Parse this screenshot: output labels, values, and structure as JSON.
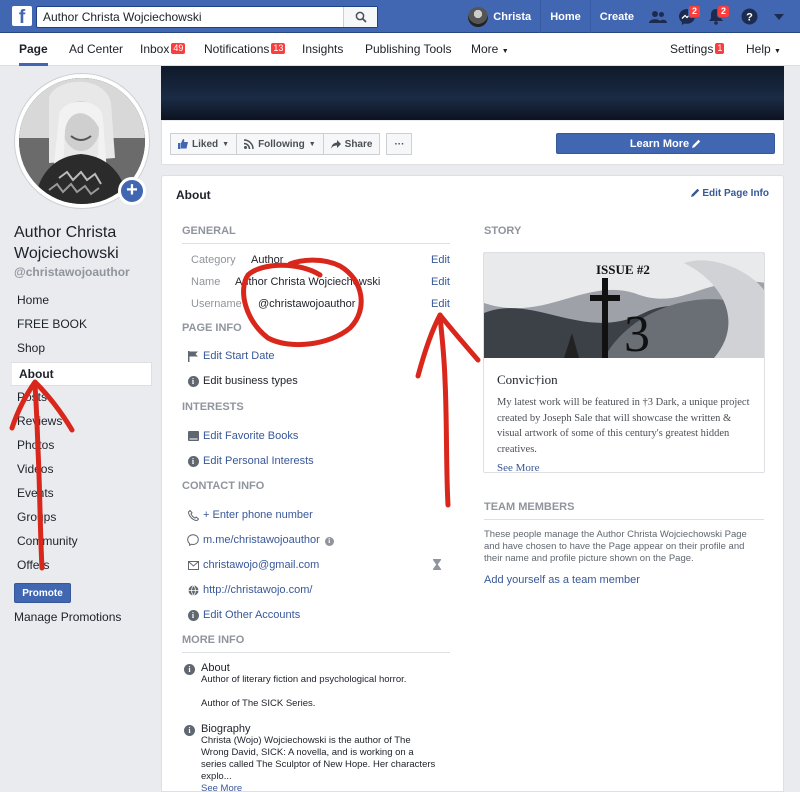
{
  "topbar": {
    "logo": "f",
    "search_value": "Author Christa Wojciechowski",
    "user_name": "Christa",
    "home": "Home",
    "create": "Create",
    "messages_badge": "2",
    "notifications_badge": "2"
  },
  "pagenav": {
    "page": "Page",
    "ad_center": "Ad Center",
    "inbox": "Inbox",
    "inbox_count": "49",
    "notifications": "Notifications",
    "notifications_count": "13",
    "insights": "Insights",
    "publishing_tools": "Publishing Tools",
    "more": "More",
    "settings": "Settings",
    "settings_count": "1",
    "help": "Help"
  },
  "sidebar": {
    "page_name": "Author Christa Wojciechowski",
    "handle": "@christawojoauthor",
    "items": [
      "Home",
      "FREE BOOK",
      "Shop",
      "About",
      "Posts",
      "Reviews",
      "Photos",
      "Videos",
      "Events",
      "Groups",
      "Community",
      "Offers"
    ],
    "promote": "Promote",
    "manage_promotions": "Manage Promotions"
  },
  "actions": {
    "liked": "Liked",
    "following": "Following",
    "share": "Share",
    "more": "···",
    "learn_more": "Learn More"
  },
  "about": {
    "title": "About",
    "edit_page_info": "Edit Page Info",
    "general": {
      "heading": "GENERAL",
      "category_label": "Category",
      "category_value": "Author",
      "name_label": "Name",
      "name_value": "Author Christa Wojciechowski",
      "username_label": "Username",
      "username_value": "@christawojoauthor",
      "edit": "Edit"
    },
    "page_info": {
      "heading": "PAGE INFO",
      "start_date": "Edit Start Date",
      "business_types": "Edit business types"
    },
    "interests": {
      "heading": "INTERESTS",
      "books": "Edit Favorite Books",
      "personal": "Edit Personal Interests"
    },
    "contact": {
      "heading": "CONTACT INFO",
      "phone": "+ Enter phone number",
      "messenger": "m.me/christawojoauthor",
      "email": "christawojo@gmail.com",
      "website": "http://christawojo.com/",
      "other": "Edit Other Accounts"
    },
    "more_info": {
      "heading": "MORE INFO",
      "about_head": "About",
      "about_body": "Author of literary fiction and psychological horror.",
      "about_body2": "Author of The SICK Series.",
      "bio_head": "Biography",
      "bio_body": "Christa (Wojo) Wojciechowski is the author of The Wrong David, SICK: A novella, and is working on a series called The Sculptor of New Hope. Her characters explo...",
      "see_more": "See More"
    }
  },
  "story": {
    "heading": "STORY",
    "image_text": "ISSUE #2",
    "title": "Convic†ion",
    "body": "My latest work will be featured in †3 Dark, a unique project created by Joseph Sale that will showcase the written & visual artwork of some of this century's greatest hidden creatives.",
    "see_more": "See More"
  },
  "team": {
    "heading": "TEAM MEMBERS",
    "text": "These people manage the Author Christa Wojciechowski Page and have chosen to have the Page appear on their profile and their name and profile picture shown on the Page.",
    "link": "Add yourself as a team member"
  },
  "colors": {
    "facebook_blue": "#4267b2",
    "link": "#385898",
    "badge_red": "#fa3e3e",
    "annotation_red": "#d9271c"
  }
}
